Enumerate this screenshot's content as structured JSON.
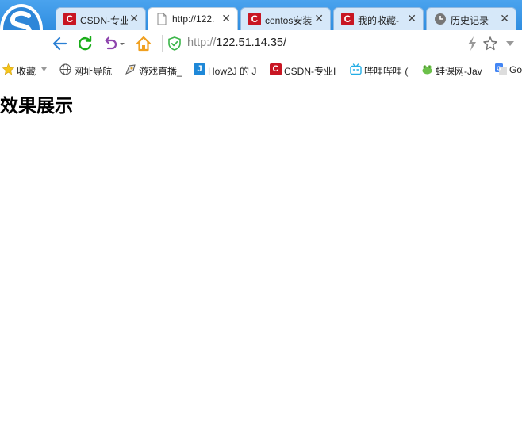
{
  "tabs": [
    {
      "title": "CSDN-专业",
      "icon": "csdn-icon",
      "active": false
    },
    {
      "title": "http://122.",
      "icon": "page-icon",
      "active": true
    },
    {
      "title": "centos安装",
      "icon": "csdn-icon",
      "active": false
    },
    {
      "title": "我的收藏-",
      "icon": "csdn-icon",
      "active": false
    },
    {
      "title": "历史记录",
      "icon": "history-clock-icon",
      "active": false
    }
  ],
  "tab_close_glyph": "✕",
  "address_bar": {
    "scheme": "http://",
    "host": "122.51.14.35/"
  },
  "bookmarks": [
    {
      "label": "收藏",
      "icon": "star-icon"
    },
    {
      "label": "网址导航",
      "icon": "globe-icon"
    },
    {
      "label": "游戏直播_",
      "icon": "game-icon"
    },
    {
      "label": "How2J 的 J",
      "icon": "how2j-icon"
    },
    {
      "label": "CSDN-专业I",
      "icon": "csdn-icon"
    },
    {
      "label": "哔哩哔哩 (",
      "icon": "bilibili-icon"
    },
    {
      "label": "蛙课网-Jav",
      "icon": "frog-icon"
    },
    {
      "label": "Go",
      "icon": "google-translate-icon"
    }
  ],
  "page": {
    "heading": "效果展示"
  },
  "colors": {
    "tabstrip": "#2f8de0",
    "csdn_red": "#c81623",
    "reload_green": "#1aad19",
    "back_blue": "#2a7fd4",
    "undo_purple": "#8e44ad",
    "home_orange": "#f0a020",
    "shield_green": "#3cb64a"
  }
}
